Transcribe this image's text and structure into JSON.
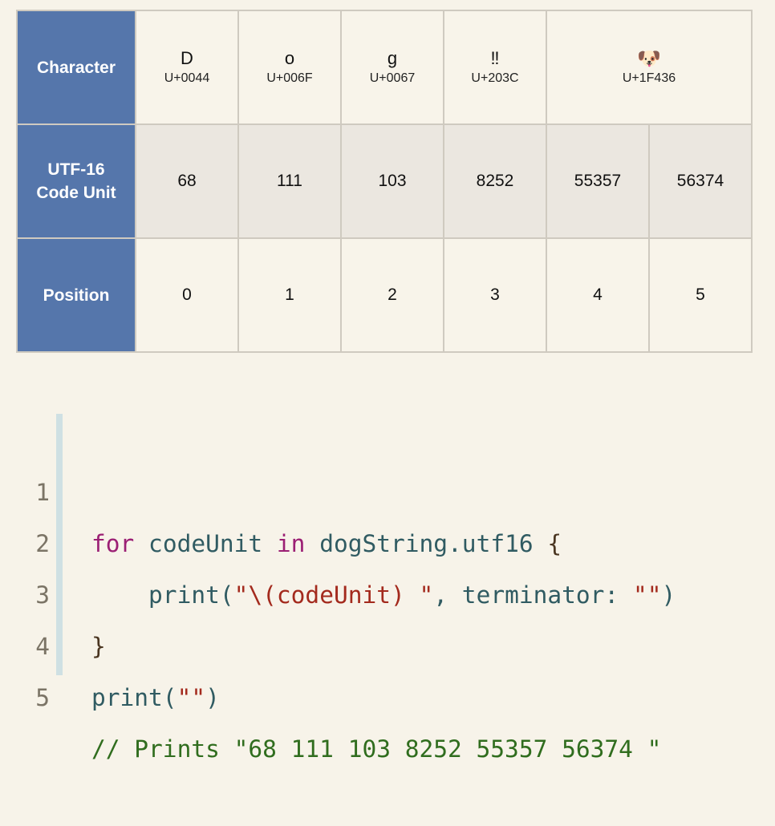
{
  "table": {
    "row_headers": {
      "character": "Character",
      "code_unit_line1": "UTF-16",
      "code_unit_line2": "Code Unit",
      "position": "Position"
    },
    "characters": [
      {
        "glyph": "D",
        "codepoint": "U+0044"
      },
      {
        "glyph": "o",
        "codepoint": "U+006F"
      },
      {
        "glyph": "g",
        "codepoint": "U+0067"
      },
      {
        "glyph": "‼",
        "codepoint": "U+203C"
      },
      {
        "glyph": "🐶",
        "codepoint": "U+1F436"
      }
    ],
    "code_units": [
      "68",
      "111",
      "103",
      "8252",
      "55357",
      "56374"
    ],
    "positions": [
      "0",
      "1",
      "2",
      "3",
      "4",
      "5"
    ]
  },
  "code": {
    "line_numbers": [
      "1",
      "2",
      "3",
      "4",
      "5"
    ],
    "tokens": {
      "l1_for": "for",
      "l1_var": " codeUnit ",
      "l1_in": "in",
      "l1_rest": " dogString.utf16 ",
      "l1_brace": "{",
      "l2_indent": "    ",
      "l2_print": "print(",
      "l2_str": "\"\\(codeUnit) \"",
      "l2_mid": ", terminator: ",
      "l2_str2": "\"\"",
      "l2_close": ")",
      "l3_brace": "}",
      "l4_print": "print(",
      "l4_str": "\"\"",
      "l4_close": ")",
      "l5_comment": "// Prints \"68 111 103 8252 55357 56374 \""
    }
  },
  "colors": {
    "header_bg": "#5576ab",
    "page_bg": "#f7f3e9",
    "keyword": "#9b1f74",
    "string": "#a32a1d",
    "comment": "#306d1e"
  }
}
